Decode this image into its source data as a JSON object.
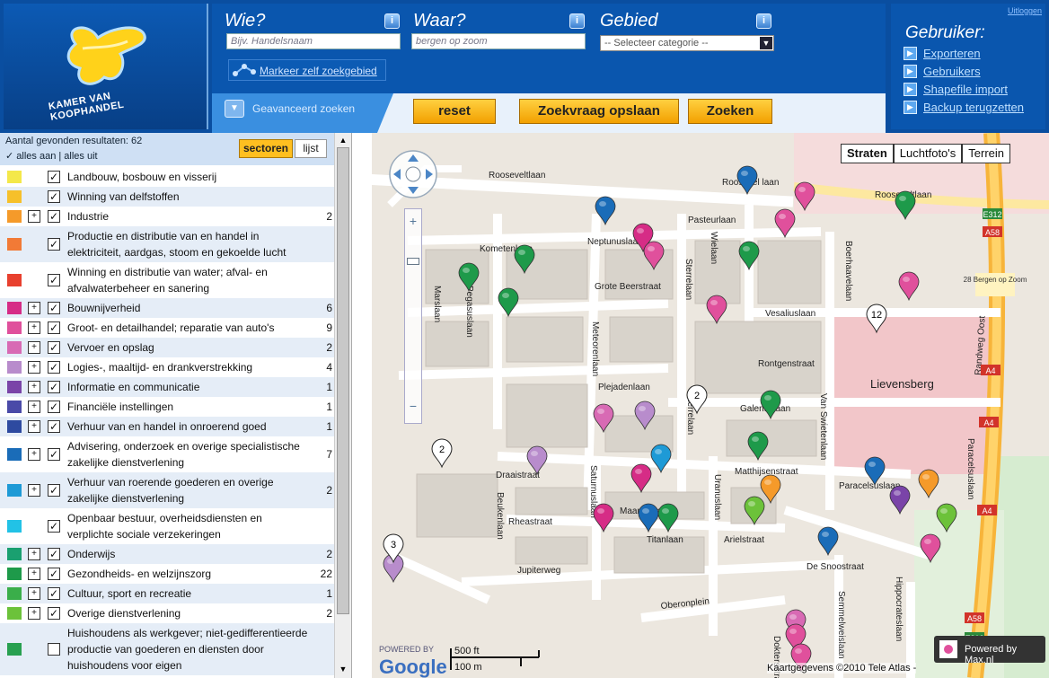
{
  "header": {
    "logo_text": "KAMER VAN KOOPHANDEL",
    "wie": {
      "label": "Wie?",
      "placeholder": "Bijv. Handelsnaam"
    },
    "waar": {
      "label": "Waar?",
      "value": "bergen op zoom"
    },
    "gebied": {
      "label": "Gebied",
      "select_value": "-- Selecteer categorie --"
    },
    "markeer_label": "Markeer zelf zoekgebied",
    "geavanceerd_label": "Geavanceerd zoeken",
    "buttons": {
      "reset": "reset",
      "opslaan": "Zoekvraag opslaan",
      "zoeken": "Zoeken"
    },
    "info_glyph": "i"
  },
  "user": {
    "title": "Gebruiker:",
    "logout": "Uitloggen",
    "links": [
      "Exporteren",
      "Gebruikers",
      "Shapefile import",
      "Backup terugzetten"
    ]
  },
  "sidebar": {
    "result_count": "Aantal gevonden resultaten: 62",
    "alles_aan": "✓ alles aan",
    "alles_uit": "| alles uit",
    "tab_sectoren": "sectoren",
    "tab_lijst": "lijst",
    "rows": [
      {
        "label": "Landbouw, bosbouw en visserij",
        "count": "",
        "color": "#f4e84a",
        "exp": false,
        "checked": true,
        "h": 22
      },
      {
        "label": "Winning van delfstoffen",
        "count": "",
        "color": "#f6c02a",
        "exp": false,
        "checked": true,
        "h": 22
      },
      {
        "label": "Industrie",
        "count": "2",
        "color": "#f59a2a",
        "exp": true,
        "checked": true,
        "h": 22
      },
      {
        "label": "Productie en distributie van en handel in elektriciteit, aardgas, stoom en gekoelde lucht",
        "count": "",
        "color": "#f27a36",
        "exp": false,
        "checked": true,
        "h": 40
      },
      {
        "label": "Winning en distributie van water; afval- en afvalwaterbeheer en sanering",
        "count": "",
        "color": "#e8402e",
        "exp": false,
        "checked": true,
        "h": 40
      },
      {
        "label": "Bouwnijverheid",
        "count": "6",
        "color": "#d62c86",
        "exp": true,
        "checked": true,
        "h": 22
      },
      {
        "label": "Groot- en detailhandel; reparatie van auto's",
        "count": "9",
        "color": "#e0509c",
        "exp": true,
        "checked": true,
        "h": 22
      },
      {
        "label": "Vervoer en opslag",
        "count": "2",
        "color": "#d86ab4",
        "exp": true,
        "checked": true,
        "h": 22
      },
      {
        "label": "Logies-, maaltijd- en drankverstrekking",
        "count": "4",
        "color": "#b88ccc",
        "exp": true,
        "checked": true,
        "h": 22
      },
      {
        "label": "Informatie en communicatie",
        "count": "1",
        "color": "#7a44a8",
        "exp": true,
        "checked": true,
        "h": 22
      },
      {
        "label": "Financiële instellingen",
        "count": "1",
        "color": "#4a4aa8",
        "exp": true,
        "checked": true,
        "h": 22
      },
      {
        "label": "Verhuur van en handel in onroerend goed",
        "count": "1",
        "color": "#2e4aa0",
        "exp": true,
        "checked": true,
        "h": 22
      },
      {
        "label": "Advisering, onderzoek en overige specialistische zakelijke dienstverlening",
        "count": "7",
        "color": "#1a6cb8",
        "exp": true,
        "checked": true,
        "h": 40
      },
      {
        "label": "Verhuur van roerende goederen en overige zakelijke dienstverlening",
        "count": "2",
        "color": "#1e9ad6",
        "exp": true,
        "checked": true,
        "h": 40
      },
      {
        "label": "Openbaar bestuur, overheidsdiensten en verplichte sociale verzekeringen",
        "count": "",
        "color": "#22c2e6",
        "exp": false,
        "checked": true,
        "h": 40
      },
      {
        "label": "Onderwijs",
        "count": "2",
        "color": "#1aa070",
        "exp": true,
        "checked": true,
        "h": 22
      },
      {
        "label": "Gezondheids- en welzijnszorg",
        "count": "22",
        "color": "#1e9a4a",
        "exp": true,
        "checked": true,
        "h": 22
      },
      {
        "label": "Cultuur, sport en recreatie",
        "count": "1",
        "color": "#3aae4a",
        "exp": true,
        "checked": true,
        "h": 22
      },
      {
        "label": "Overige dienstverlening",
        "count": "2",
        "color": "#6cc23a",
        "exp": true,
        "checked": true,
        "h": 22
      },
      {
        "label": "Huishoudens als werkgever; niet-gedifferentieerde productie van goederen en diensten door huishoudens voor eigen",
        "count": "",
        "color": "#28a050",
        "exp": false,
        "checked": false,
        "h": 58
      }
    ]
  },
  "map": {
    "types": [
      "Straten",
      "Luchtfoto's",
      "Terrein"
    ],
    "streets": [
      "Rooseveltlaan",
      "Roosevel laan",
      "Rooseveltlaan",
      "Pasteurlaan",
      "Kometenlaan",
      "Neptunuslaan",
      "Grote Beerstraat",
      "Marslaan",
      "Pegasuslaan",
      "Meteorenlaan",
      "Sterrelaan",
      "Wielaan",
      "Boerhaavelaan",
      "Vesaliuslaan",
      "Rontgenstraat",
      "Lievensberg",
      "Van Swietenlaan",
      "Plejadenlaan",
      "Galenuslaan",
      "Sterrelaan",
      "Paracelsuslaan",
      "Matthijsenstraat",
      "Draaistraat",
      "Saturnuslaan",
      "Uranuslaan",
      "Paracelsuslaan",
      "Beukenlaan",
      "Rheastraat",
      "Maanstraat",
      "Titanlaan",
      "Arielstraat",
      "Jupiterweg",
      "De Snoostraat",
      "Oberonplein",
      "Hippocrateslaan",
      "Semmelweislaan",
      "Randweg Oost",
      "Doktersstraat"
    ],
    "road_labels": [
      "E312",
      "A58",
      "28 Bergen op Zoom",
      "A4",
      "A4",
      "A4",
      "E312",
      "A58"
    ],
    "cluster_labels": [
      "2",
      "12",
      "2",
      "3"
    ],
    "powered_by_google": "POWERED BY",
    "google": "Google",
    "scale_ft": "500 ft",
    "scale_m": "100 m",
    "attribution": "Kaartgegevens ©2010 Tele Atlas -",
    "powered_by_max": "Powered by Max.nl",
    "pins": [
      {
        "color": "#1a6cb8"
      },
      {
        "color": "#e0509c"
      },
      {
        "color": "#1e9a4a"
      },
      {
        "color": "#1a6cb8"
      },
      {
        "color": "#e0509c"
      },
      {
        "color": "#d62c86"
      },
      {
        "color": "#e0509c"
      },
      {
        "color": "#1e9a4a"
      },
      {
        "color": "#1e9a4a"
      },
      {
        "color": "#e0509c"
      },
      {
        "color": "#1e9a4a"
      },
      {
        "color": "#1e9a4a"
      },
      {
        "color": "#e0509c"
      },
      {
        "color": "#d86ab4"
      },
      {
        "color": "#b88ccc"
      },
      {
        "color": "#1e9a4a"
      },
      {
        "color": "#1e9a4a"
      },
      {
        "color": "#b88ccc"
      },
      {
        "color": "#1e9ad6"
      },
      {
        "color": "#d62c86"
      },
      {
        "color": "#f59a2a"
      },
      {
        "color": "#1a6cb8"
      },
      {
        "color": "#7a44a8"
      },
      {
        "color": "#f59a2a"
      },
      {
        "color": "#d62c86"
      },
      {
        "color": "#1a6cb8"
      },
      {
        "color": "#1e9a4a"
      },
      {
        "color": "#6cc23a"
      },
      {
        "color": "#1a6cb8"
      },
      {
        "color": "#e0509c"
      },
      {
        "color": "#6cc23a"
      },
      {
        "color": "#d86ab4"
      },
      {
        "color": "#e0509c"
      },
      {
        "color": "#e0509c"
      },
      {
        "color": "#b88ccc"
      }
    ]
  }
}
